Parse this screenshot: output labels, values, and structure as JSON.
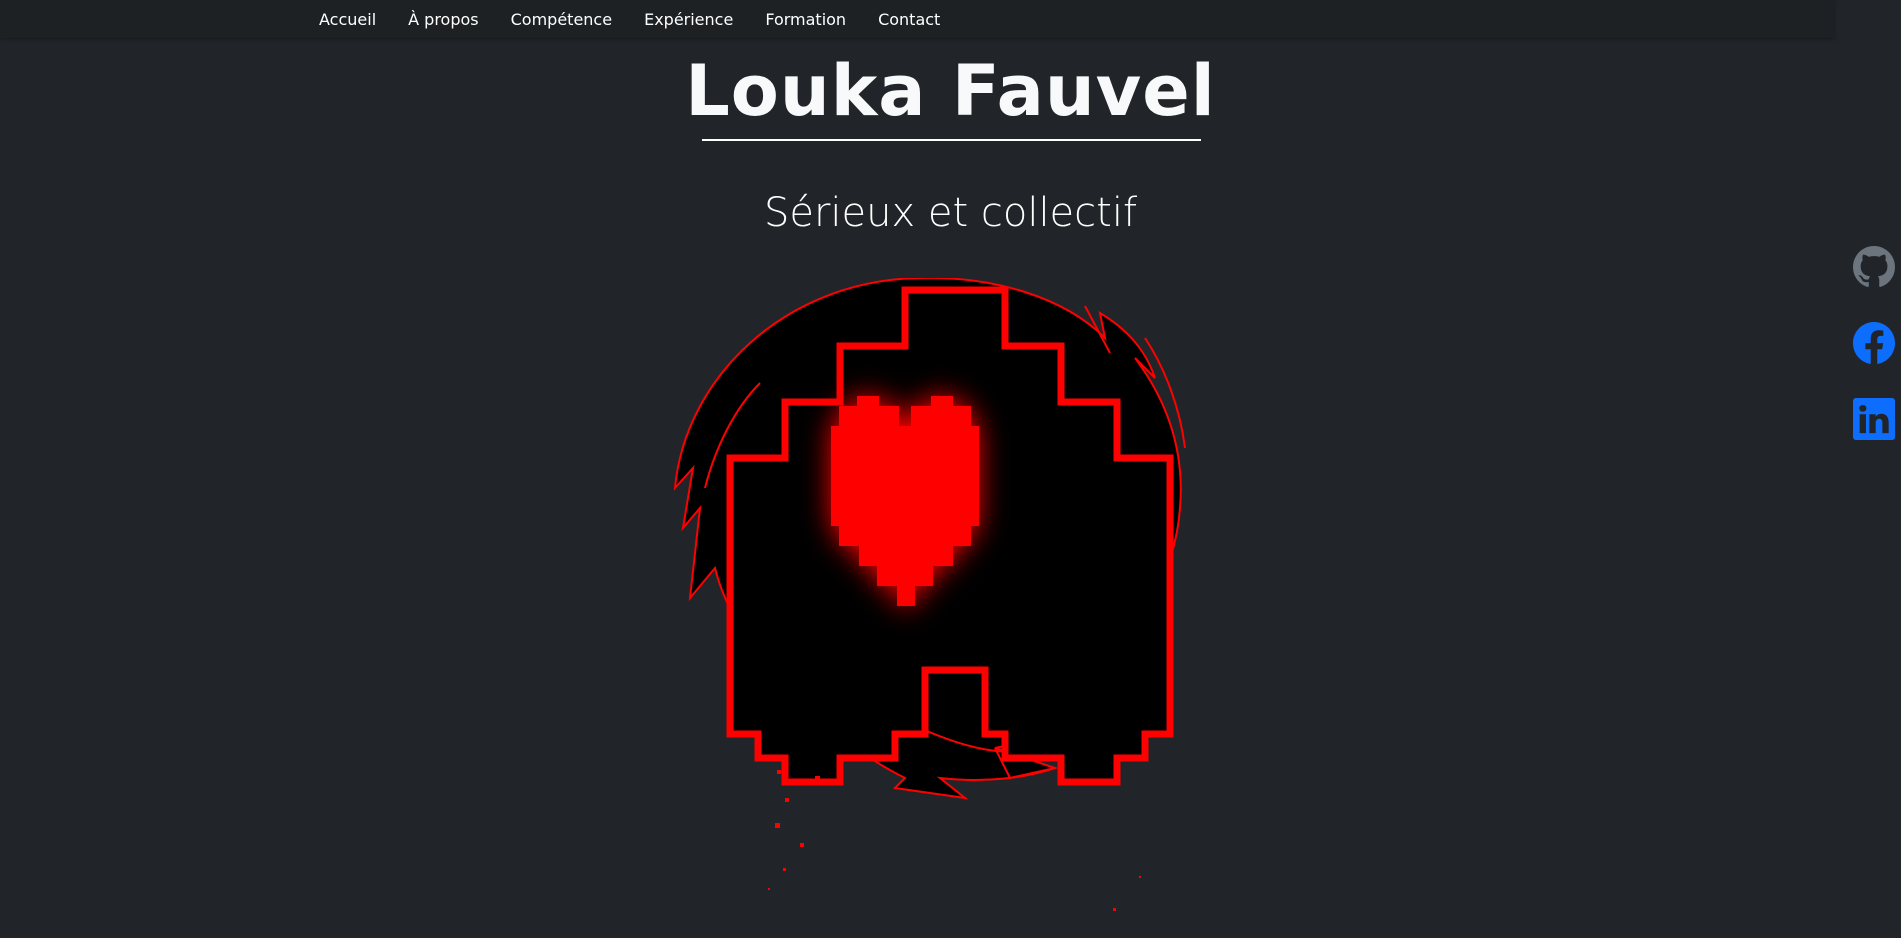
{
  "nav": {
    "items": [
      {
        "label": "Accueil"
      },
      {
        "label": "À propos"
      },
      {
        "label": "Compétence"
      },
      {
        "label": "Expérience"
      },
      {
        "label": "Formation"
      },
      {
        "label": "Contact"
      }
    ]
  },
  "hero": {
    "name": "Louka Fauvel",
    "tagline": "Sérieux et collectif"
  },
  "socials": [
    {
      "icon": "github-icon",
      "color": "#6c757d"
    },
    {
      "icon": "facebook-icon",
      "color": "#0d6efd"
    },
    {
      "icon": "linkedin-icon",
      "color": "#0d6efd"
    }
  ],
  "colors": {
    "background": "#212529",
    "navbar": "#1d2124",
    "accent": "#ff0000",
    "text": "#ffffff"
  }
}
